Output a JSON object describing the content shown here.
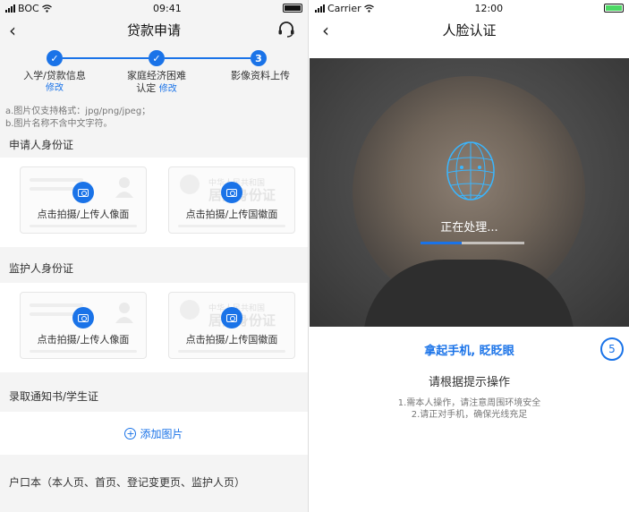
{
  "left_phone": {
    "status": {
      "carrier": "BOC",
      "time": "09:41"
    },
    "nav": {
      "title": "贷款申请"
    },
    "steps": [
      {
        "label": "入学/贷款信息",
        "edit": "修改",
        "state": "done"
      },
      {
        "label_line1": "家庭经济困难",
        "label_line2": "认定",
        "edit": "修改",
        "state": "done"
      },
      {
        "label": "影像资料上传",
        "number": "3",
        "state": "current"
      }
    ],
    "hints": [
      "a.图片仅支持格式：jpg/png/jpeg；",
      "b.图片名称不含中文字符。"
    ],
    "sections": [
      {
        "title": "申请人身份证",
        "front_caption": "点击拍摄/上传人像面",
        "back_caption": "点击拍摄/上传国徽面"
      },
      {
        "title": "监护人身份证",
        "front_caption": "点击拍摄/上传人像面",
        "back_caption": "点击拍摄/上传国徽面"
      },
      {
        "title": "录取通知书/学生证",
        "add_label": "添加图片"
      },
      {
        "title": "户口本（本人页、首页、登记变更页、监护人页）"
      }
    ],
    "card_watermark": {
      "line1": "中华人民共和国",
      "line2": "居民身份证"
    }
  },
  "right_phone": {
    "status": {
      "carrier": "Carrier",
      "time": "12:00"
    },
    "nav": {
      "title": "人脸认证"
    },
    "processing_text": "正在处理...",
    "progress_fraction": 0.4,
    "instruction_main": "拿起手机, 眨眨眼",
    "countdown": "5",
    "instruction_sub": "请根据提示操作",
    "tips": [
      "1.需本人操作，请注意周围环境安全",
      "2.请正对手机，确保光线充足"
    ]
  },
  "colors": {
    "accent": "#1a73e8",
    "background": "#f4f4f4"
  }
}
